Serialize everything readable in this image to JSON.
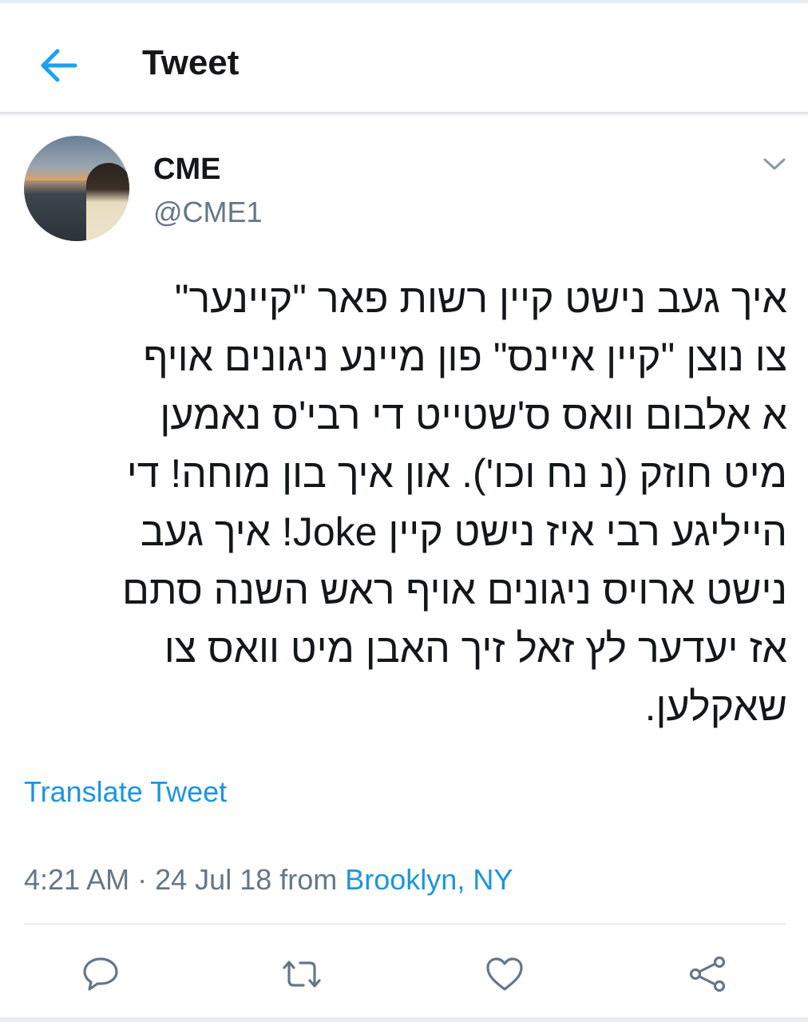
{
  "header": {
    "back_icon": "arrow-left-icon",
    "title": "Tweet",
    "accent": "#1da1f2"
  },
  "tweet": {
    "author_name": "CME",
    "author_handle": "@CME1",
    "avatar": "avatar-photo",
    "menu_icon": "chevron-down-icon",
    "text_lines": [
      "איך געב נישט קיין רשות פאר \"קיינער\"",
      "צו נוצן \"קיין איינס\" פון מיינע ניגונים אויף",
      "א אלבום וואס ס'שטייט די רבי'ס נאמען",
      "מיט חוזק (נ נח וכו'). און איך בון מוחה! די",
      "הייליגע רבי איז נישט קיין Joke! איך געב",
      "נישט ארויס ניגונים אויף ראש השנה סתם",
      "אז יעדער לץ זאל זיך האבן מיט וואס צו",
      "שאקלען."
    ],
    "translate_label": "Translate Tweet",
    "time": "4:21 AM",
    "separator": "·",
    "date": "24 Jul 18",
    "from_label": "from",
    "location": "Brooklyn, NY"
  },
  "actions": [
    {
      "icon": "reply-icon"
    },
    {
      "icon": "retweet-icon"
    },
    {
      "icon": "like-icon"
    },
    {
      "icon": "share-icon"
    }
  ],
  "colors": {
    "text": "#14171a",
    "secondary": "#657786",
    "link": "#1b95e0",
    "divider": "#e6ecf0"
  }
}
